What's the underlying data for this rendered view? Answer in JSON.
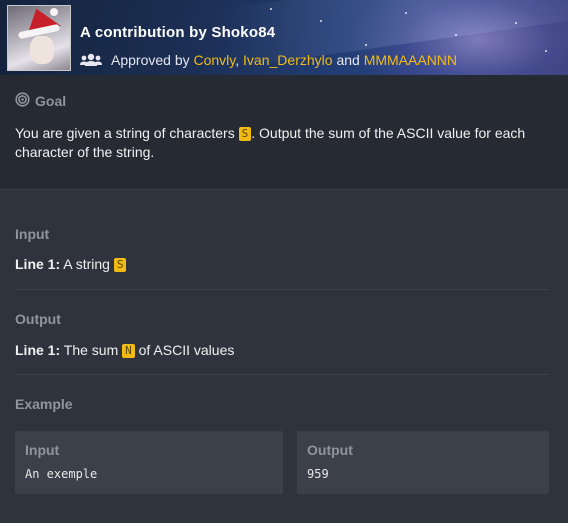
{
  "header": {
    "title": "A contribution by Shoko84",
    "approved_prefix": "Approved by",
    "approvers": [
      "Convly",
      "Ivan_Derzhylo",
      "MMMAAANNN"
    ],
    "separator_comma": ",",
    "separator_and": "and",
    "avatar_icon": "user-avatar",
    "group_icon": "users-icon"
  },
  "goal": {
    "label": "Goal",
    "icon": "target-icon",
    "text_before": "You are given a string of characters",
    "var": "S",
    "text_after": ". Output the sum of the ASCII value for each character of the string."
  },
  "input": {
    "label": "Input",
    "line_label": "Line 1:",
    "line_text": "A string",
    "var": "S"
  },
  "output": {
    "label": "Output",
    "line_label": "Line 1:",
    "line_text_before": "The sum",
    "var": "N",
    "line_text_after": "of ASCII values"
  },
  "example": {
    "label": "Example",
    "input_label": "Input",
    "input_value": "An exemple",
    "output_label": "Output",
    "output_value": "959"
  },
  "colors": {
    "accent": "#f2bb13",
    "background": "#2f333d",
    "goal_background": "#262a33",
    "muted_label": "#8f95a0"
  }
}
